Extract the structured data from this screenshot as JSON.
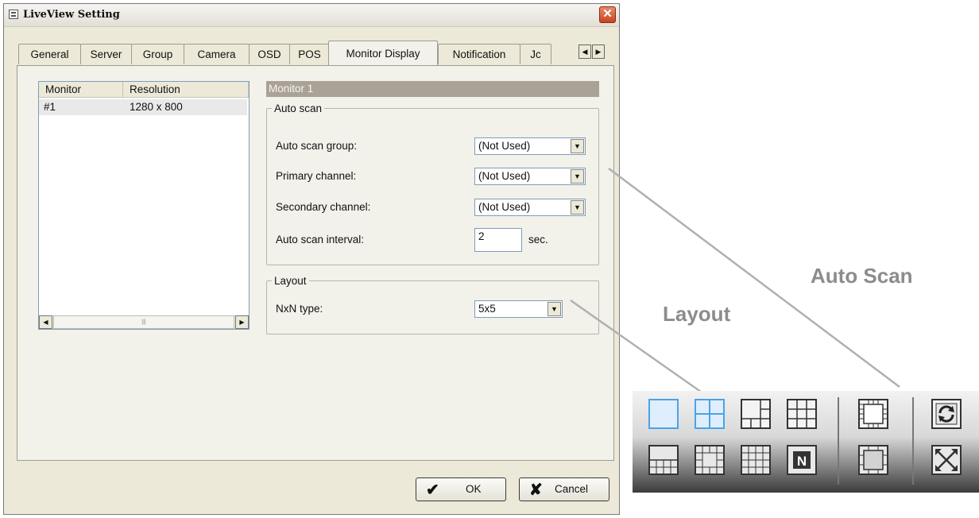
{
  "dialog": {
    "title": "LiveView Setting",
    "close_glyph": "✕",
    "tabs": [
      "General",
      "Server",
      "Group",
      "Camera",
      "OSD",
      "POS",
      "Monitor Display",
      "Notification",
      "Jc"
    ],
    "active_tab": "Monitor Display",
    "tab_scroll_left": "◀",
    "tab_scroll_right": "▶"
  },
  "monitor_list": {
    "columns": [
      "Monitor",
      "Resolution"
    ],
    "rows": [
      {
        "monitor": "#1",
        "resolution": "1280 x 800"
      }
    ],
    "scroll_left": "◀",
    "scroll_right": "▶",
    "scroll_thumb": "|||"
  },
  "monitor_heading": "Monitor 1",
  "auto_scan": {
    "legend": "Auto scan",
    "group_label": "Auto scan group:",
    "group_value": "(Not Used)",
    "primary_label": "Primary channel:",
    "primary_value": "(Not Used)",
    "secondary_label": "Secondary channel:",
    "secondary_value": "(Not Used)",
    "interval_label": "Auto scan interval:",
    "interval_value": "2",
    "interval_unit": "sec."
  },
  "layout": {
    "legend": "Layout",
    "nxn_label": "NxN type:",
    "nxn_value": "5x5"
  },
  "buttons": {
    "ok": "OK",
    "ok_glyph": "✔",
    "cancel": "Cancel",
    "cancel_glyph": "✘"
  },
  "callouts": {
    "auto_scan": "Auto Scan",
    "layout": "Layout"
  },
  "toolbar_icons": [
    "single-view-icon",
    "quad-view-icon",
    "six-view-icon",
    "nine-view-icon",
    "full-grid-icon",
    "auto-scan-icon",
    "ten-view-icon",
    "thirteen-view-icon",
    "sixteen-view-icon",
    "nxn-layout-icon",
    "full-screen-grid-icon",
    "full-screen-icon"
  ],
  "toolbar_nxn_glyph": "N"
}
